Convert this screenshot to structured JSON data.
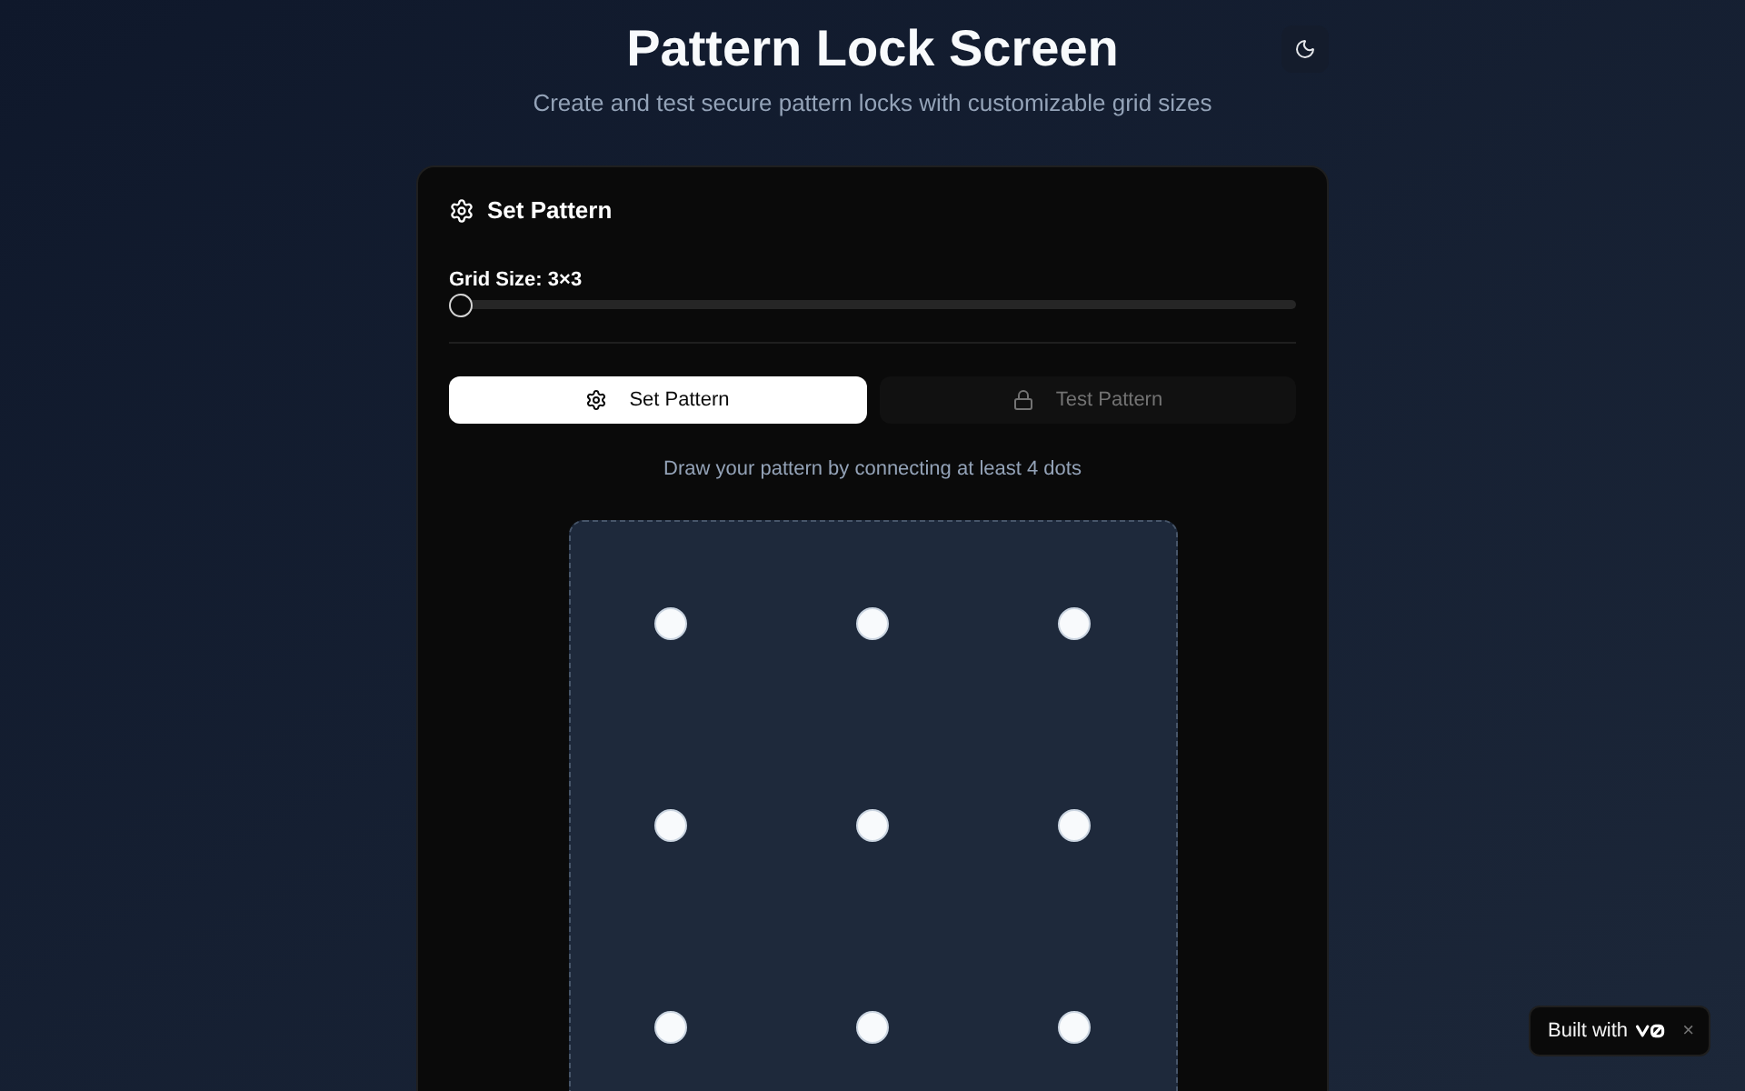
{
  "header": {
    "title": "Pattern Lock Screen",
    "subtitle": "Create and test secure pattern locks with customizable grid sizes"
  },
  "card": {
    "title": "Set Pattern",
    "grid_size": {
      "label": "Grid Size: 3×3",
      "level": 0
    },
    "tabs": [
      {
        "label": "Set Pattern",
        "selected": true,
        "kind": "settings"
      },
      {
        "label": "Test Pattern",
        "selected": false,
        "kind": "lock"
      }
    ],
    "instruction": "Draw your pattern by connecting at least 4 dots",
    "pattern_pad": {
      "rows": [
        {
          "dots": [
            {
              "selected": false
            },
            {
              "selected": false
            },
            {
              "selected": false
            }
          ]
        },
        {
          "dots": [
            {
              "selected": false
            },
            {
              "selected": false
            },
            {
              "selected": false
            }
          ]
        },
        {
          "dots": [
            {
              "selected": false
            },
            {
              "selected": false
            },
            {
              "selected": false
            }
          ]
        }
      ]
    }
  },
  "badge": {
    "label": "Built with",
    "close": "×"
  }
}
